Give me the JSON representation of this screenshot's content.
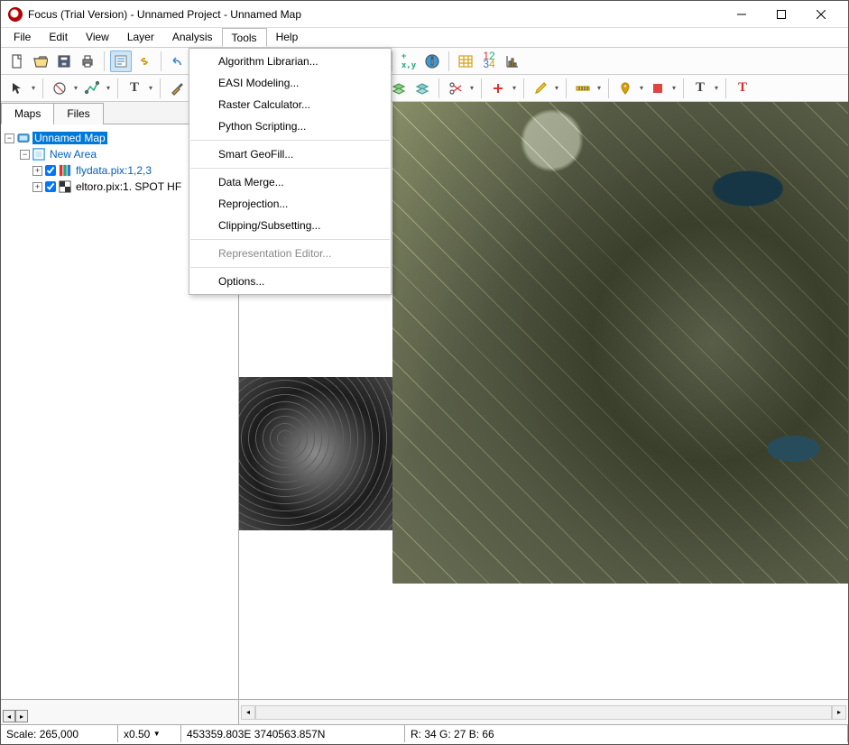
{
  "window": {
    "title": "Focus (Trial Version) - Unnamed Project - Unnamed Map"
  },
  "menubar": {
    "items": [
      "File",
      "Edit",
      "View",
      "Layer",
      "Analysis",
      "Tools",
      "Help"
    ],
    "open_index": 5
  },
  "tools_menu": {
    "groups": [
      [
        "Algorithm Librarian...",
        "EASI Modeling...",
        "Raster Calculator...",
        "Python Scripting..."
      ],
      [
        "Smart GeoFill..."
      ],
      [
        "Data Merge...",
        "Reprojection...",
        "Clipping/Subsetting..."
      ],
      [
        "Representation Editor..."
      ],
      [
        "Options..."
      ]
    ],
    "disabled": [
      "Representation Editor..."
    ]
  },
  "side_tabs": {
    "items": [
      "Maps",
      "Files"
    ],
    "active": 0
  },
  "tree": {
    "root": "Unnamed Map",
    "area": "New Area",
    "layers": [
      {
        "label": "flydata.pix:1,2,3",
        "icon": "rgb"
      },
      {
        "label": "eltoro.pix:1. SPOT HF",
        "icon": "bw"
      }
    ]
  },
  "status": {
    "scale_label": "Scale:",
    "scale_value": "265,000",
    "zoom": "x0.50",
    "coords": "453359.803E 3740563.857N",
    "rgb": "R: 34 G: 27 B: 66"
  },
  "toolbar_icons": {
    "row1": [
      "new",
      "open",
      "save",
      "print",
      "|",
      "report",
      "link",
      "|",
      "undo",
      "redo",
      "|",
      "extent",
      "zoomwin",
      "zoomin",
      "zoomout",
      "zoomlayer",
      "pan",
      "overview",
      "|",
      "xy",
      "info",
      "|",
      "table",
      "legend",
      "chart"
    ],
    "row2": [
      "arrow",
      "|",
      "nopoint",
      "polyline",
      "|",
      "text",
      "|",
      "brush",
      "|",
      "color-red",
      "color-blue",
      "color-green",
      "color-yellow",
      "|",
      "shape",
      "|",
      "rgb",
      "|",
      "stack1",
      "stack2",
      "|",
      "scissors",
      "|",
      "plus",
      "|",
      "pencil",
      "|",
      "measure",
      "|",
      "pin",
      "fill",
      "|",
      "T1",
      "|",
      "T2"
    ]
  }
}
